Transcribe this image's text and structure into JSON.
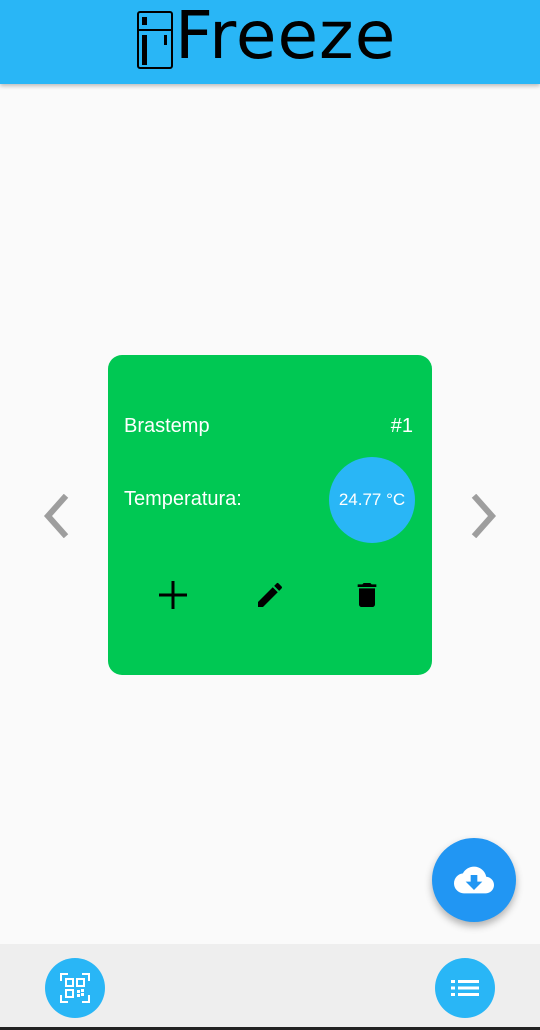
{
  "app": {
    "title_prefix": "i",
    "title_rest": "Freeze",
    "accent_color": "#29b6f6",
    "card_color": "#00c853",
    "fab_color": "#2196f3"
  },
  "device_card": {
    "name": "Brastemp",
    "index": "#1",
    "temperature_label": "Temperatura:",
    "temperature_value": "24.77 °C",
    "actions": [
      {
        "name": "add",
        "icon": "plus-icon"
      },
      {
        "name": "edit",
        "icon": "pencil-icon"
      },
      {
        "name": "delete",
        "icon": "trash-icon"
      }
    ]
  },
  "navigation": {
    "prev_icon": "chevron-left-icon",
    "next_icon": "chevron-right-icon"
  },
  "fab": {
    "icon": "cloud-download-icon"
  },
  "bottom_bar": {
    "left_icon": "qr-code-scan-icon",
    "right_icon": "list-icon"
  }
}
